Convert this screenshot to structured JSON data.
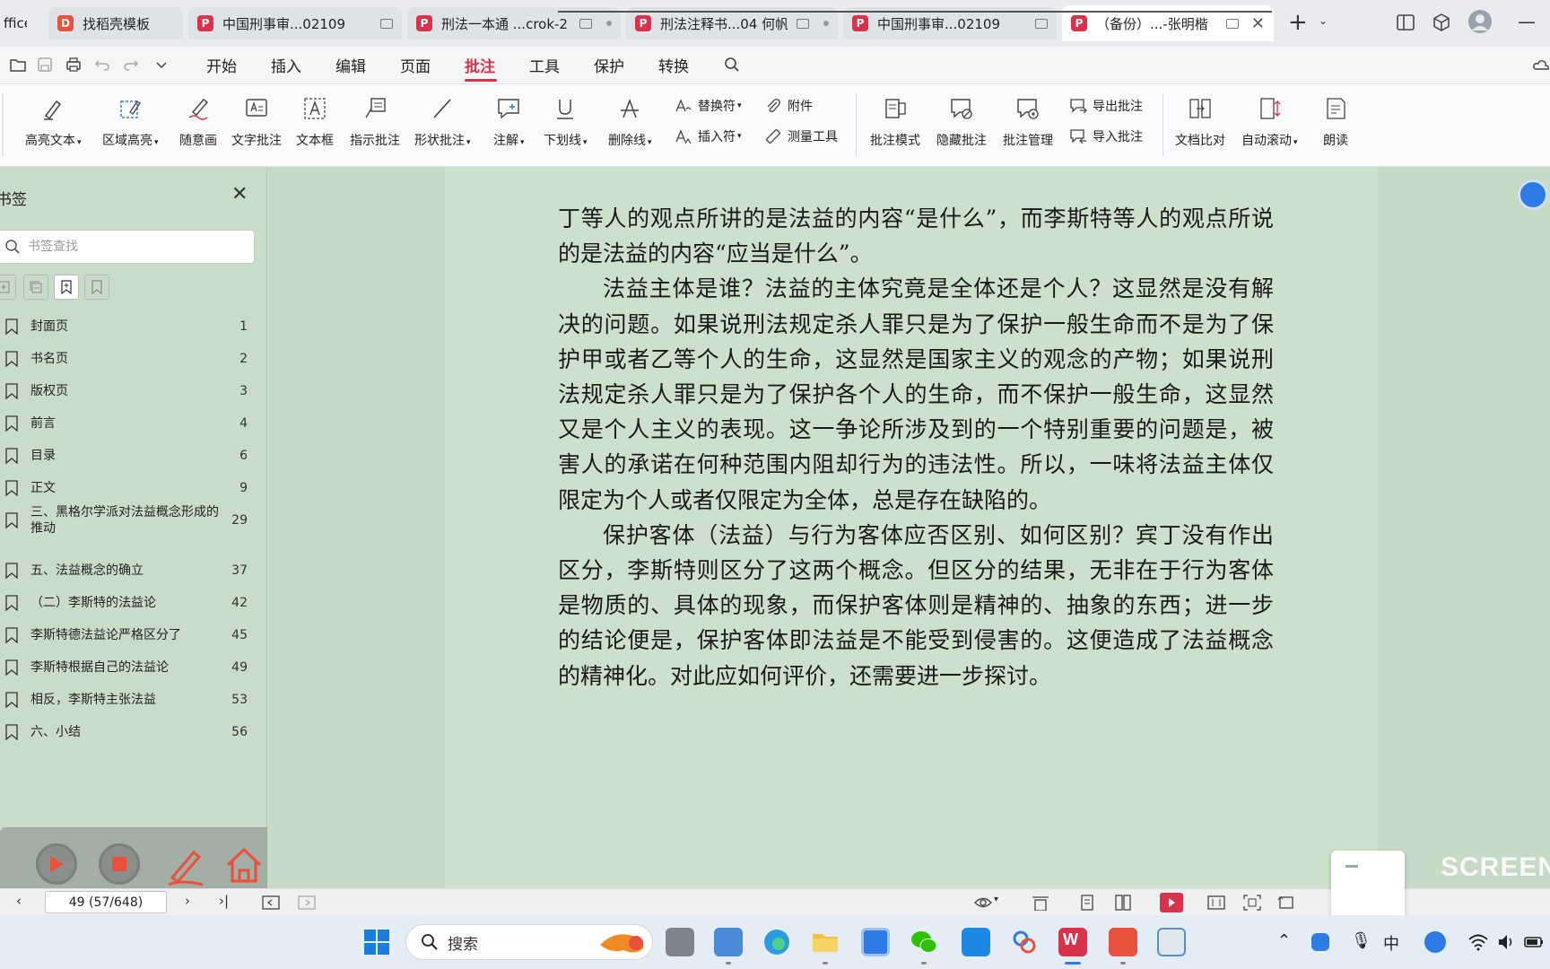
{
  "tabs": [
    {
      "label": "ffice",
      "kind": "partial"
    },
    {
      "label": "找稻壳模板",
      "kind": "orange"
    },
    {
      "label": "中国刑事审...02109",
      "kind": "pdf"
    },
    {
      "label": "刑法一本通 ...crok-2",
      "kind": "pdf"
    },
    {
      "label": "刑法注释书...04 何帆",
      "kind": "pdf"
    },
    {
      "label": "中国刑事审...02109",
      "kind": "pdf"
    },
    {
      "label": "（备份）...-张明楷",
      "kind": "pdf-active"
    }
  ],
  "menu": [
    "开始",
    "插入",
    "编辑",
    "页面",
    "批注",
    "工具",
    "保护",
    "转换"
  ],
  "menu_active": "批注",
  "ribbon": {
    "highlight_text": "高亮文本",
    "area_highlight": "区域高亮",
    "freehand": "随意画",
    "text_comment": "文字批注",
    "text_box": "文本框",
    "pointer_comment": "指示批注",
    "shape_comment": "形状批注",
    "note": "注解",
    "underline": "下划线",
    "strikethrough": "删除线",
    "replace_mark": "替换符",
    "insert_mark": "插入符",
    "attachment": "附件",
    "measure_tool": "测量工具",
    "comment_mode": "批注模式",
    "hide_comments": "隐藏批注",
    "comment_manage": "批注管理",
    "export_comments": "导出批注",
    "import_comments": "导入批注",
    "doc_compare": "文档比对",
    "auto_scroll": "自动滚动",
    "read_aloud": "朗读"
  },
  "sidebar": {
    "title": "书签",
    "search_placeholder": "书签查找",
    "bookmarks": [
      {
        "label": "封面页",
        "page": "1"
      },
      {
        "label": "书名页",
        "page": "2"
      },
      {
        "label": "版权页",
        "page": "3"
      },
      {
        "label": "前言",
        "page": "4"
      },
      {
        "label": "目录",
        "page": "6"
      },
      {
        "label": "正文",
        "page": "9"
      },
      {
        "label": "三、黑格尔学派对法益概念形成的推动",
        "page": "29"
      },
      {
        "label": "五、法益概念的确立",
        "page": "37"
      },
      {
        "label": "（二）李斯特的法益论",
        "page": "42"
      },
      {
        "label": "李斯特德法益论严格区分了",
        "page": "45"
      },
      {
        "label": "李斯特根据自己的法益论",
        "page": "49"
      },
      {
        "label": "相反，李斯特主张法益",
        "page": "53"
      },
      {
        "label": "六、小结",
        "page": "56"
      }
    ]
  },
  "document": {
    "paragraphs": [
      {
        "indent": false,
        "text": "丁等人的观点所讲的是法益的内容“是什么”，而李斯特等人的观点所说的是法益的内容“应当是什么”。"
      },
      {
        "indent": true,
        "text": "法益主体是谁？法益的主体究竟是全体还是个人？这显然是没有解决的问题。如果说刑法规定杀人罪只是为了保护一般生命而不是为了保护甲或者乙等个人的生命，这显然是国家主义的观念的产物；如果说刑法规定杀人罪只是为了保护各个人的生命，而不保护一般生命，这显然又是个人主义的表现。这一争论所涉及到的一个特别重要的问题是，被害人的承诺在何种范围内阻却行为的违法性。所以，一味将法益主体仅限定为个人或者仅限定为全体，总是存在缺陷的。"
      },
      {
        "indent": true,
        "text": "保护客体（法益）与行为客体应否区别、如何区别？宾丁没有作出区分，李斯特则区分了这两个概念。但区分的结果，无非在于行为客体是物质的、具体的现象，而保护客体则是精神的、抽象的东西；进一步的结论便是，保护客体即法益是不能受到侵害的。这便造成了法益概念的精神化。对此应如何评价，还需要进一步探讨。"
      }
    ]
  },
  "statusbar": {
    "page_indicator": "49 (57/648)"
  },
  "taskbar": {
    "search_label": "搜索",
    "ime_label": "中"
  },
  "watermark": "SCREEN",
  "colors": {
    "accent": "#d9324a",
    "page_background": "#cde0cb",
    "sidebar_background": "#c9dcc8"
  }
}
